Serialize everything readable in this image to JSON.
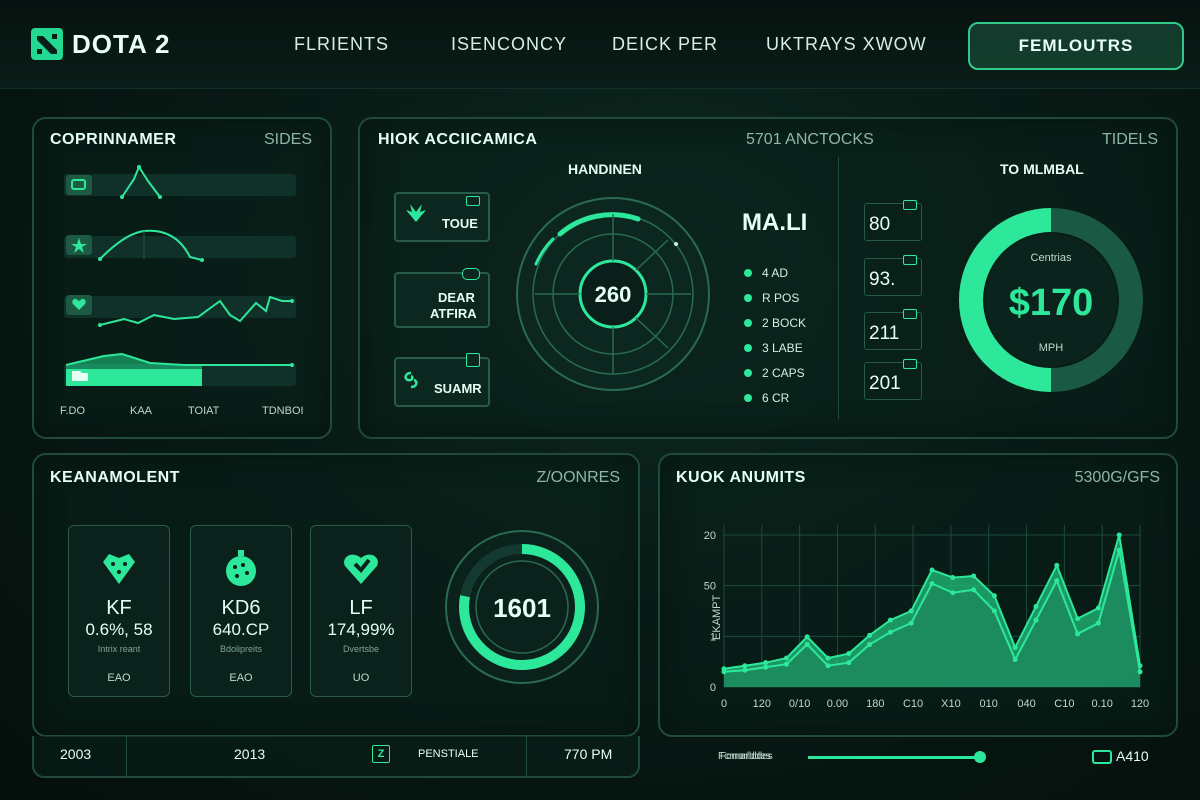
{
  "header": {
    "logo_text": "DOTA 2",
    "nav": [
      "FLRIENTS",
      "ISENCONCY",
      "DEICK PER",
      "UKTRAYS XWOW"
    ],
    "cta_label": "FEMLOUTRS"
  },
  "panel1": {
    "title": "COPRINNAMER",
    "meta": "SIDES",
    "footer_labels": [
      "F.DO",
      "KAA",
      "TOIAT",
      "TDNBOI"
    ]
  },
  "panel2": {
    "title": "HIOK ACCIICAMICA",
    "meta": "5701 ANCTOCKS",
    "meta_right": "TIDELS",
    "section_left": "HANDINEN",
    "section_right": "TO MLMBAL",
    "cards": [
      "TOUE",
      "DEAR",
      "ATFIRA",
      "SUAMR"
    ],
    "radar_center": "260",
    "stat_title": "MA.LI",
    "legend": [
      "4 AD",
      "R POS",
      "2 BOCK",
      "3 LABE",
      "2 CAPS",
      "6 CR"
    ],
    "small_stats": [
      "80",
      "93.",
      "211",
      "201"
    ],
    "donut_label_top": "Centrias",
    "donut_value": "$170",
    "donut_label_bottom": "MPH",
    "donut_fill": 0.5
  },
  "panel3": {
    "title": "KEANAMOLENT",
    "meta": "Z/OONRES",
    "heroes": [
      {
        "code": "KF",
        "stat": "0.6%, 58",
        "sub": "Intrix reant",
        "foot": "EAO"
      },
      {
        "code": "KD6",
        "stat": "640.CP",
        "sub": "Bdolipreits",
        "foot": "EAO"
      },
      {
        "code": "LF",
        "stat": "174,99%",
        "sub": "Dvertsbe",
        "foot": "UO"
      }
    ],
    "gauge_value": "1601",
    "gauge_fill": 0.78
  },
  "panel4": {
    "title": "KUOK ANUMITS",
    "meta": "5300G/GFS",
    "ylabel": "EKAMPT",
    "footer_label": "Fcrnarlddes",
    "footer_value": "A410"
  },
  "footer": {
    "left": "2003",
    "mid": "2013",
    "icon_label": "PENSTIALE",
    "time": "770 PM"
  },
  "chart_data": {
    "type": "area",
    "x": [
      "0",
      "120",
      "0/10",
      "0.00",
      "180",
      "C10",
      "X10",
      "010",
      "040",
      "C10",
      "0.10",
      "120"
    ],
    "y_ticks": [
      "0",
      "1",
      "50",
      "20"
    ],
    "series": [
      {
        "values": [
          0.1,
          0.11,
          0.13,
          0.15,
          0.28,
          0.14,
          0.16,
          0.28,
          0.36,
          0.42,
          0.68,
          0.62,
          0.64,
          0.5,
          0.18,
          0.44,
          0.7,
          0.35,
          0.42,
          0.9,
          0.1
        ]
      },
      {
        "values": [
          0.12,
          0.14,
          0.16,
          0.19,
          0.33,
          0.19,
          0.22,
          0.34,
          0.44,
          0.5,
          0.77,
          0.72,
          0.73,
          0.6,
          0.26,
          0.53,
          0.8,
          0.45,
          0.52,
          1.0,
          0.14
        ]
      }
    ]
  }
}
